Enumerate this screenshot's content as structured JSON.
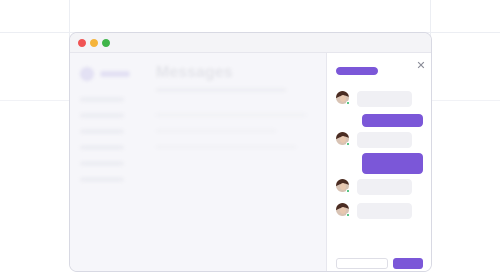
{
  "main": {
    "title": "Messages"
  },
  "panel": {
    "close_symbol": "✕",
    "accent_color": "#7b57d8",
    "online_color": "#25b561",
    "messages": [
      {
        "direction": "incoming",
        "has_avatar": true
      },
      {
        "direction": "outgoing"
      },
      {
        "direction": "incoming",
        "has_avatar": true
      },
      {
        "direction": "outgoing"
      },
      {
        "direction": "incoming",
        "has_avatar": true
      },
      {
        "direction": "incoming",
        "has_avatar": true
      }
    ]
  },
  "icons": {
    "window_controls": [
      "close-dot",
      "minimize-dot",
      "maximize-dot"
    ],
    "avatar": "user-avatar-icon"
  }
}
